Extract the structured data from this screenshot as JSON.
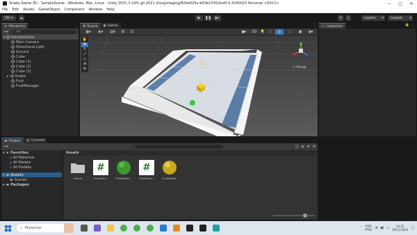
{
  "window": {
    "title": "Snake-Game-3D - SampleScene - Windows, Mac, Linux - Unity 2021.3.10f1.git.2021.3/evg/staging/82bb020e-b03b1330/draft-0.4200023 Personal <DX11>",
    "controls": [
      "—",
      "□",
      "✕"
    ]
  },
  "menu": [
    "File",
    "Edit",
    "Assets",
    "GameObject",
    "Component",
    "Window",
    "Help"
  ],
  "toolbar": {
    "account_label": "DG ▾",
    "play": "▶",
    "pause": "❚❚",
    "step": "▶|",
    "layers_label": "Layers",
    "layout_label": "Layout"
  },
  "hierarchy": {
    "tab": "Hierarchy",
    "search_placeholder": "All",
    "scene": "SampleScene",
    "items": [
      "Main Camera",
      "Directional Light",
      "Ground",
      "Cube",
      "Cube (1)",
      "Cube (2)",
      "Cube (3)",
      "Snake",
      "Fruit",
      "FruitManager"
    ]
  },
  "scene_view": {
    "tabs": [
      "Scene",
      "Game"
    ],
    "mode_2d": "2D",
    "persp_label": "< Persp"
  },
  "inspector": {
    "tab": "Inspector"
  },
  "project": {
    "tabs": [
      "Project",
      "Console"
    ],
    "favorites": {
      "title": "Favorites",
      "items": [
        "All Materials",
        "All Models",
        "All Prefabs"
      ]
    },
    "assets_tree": {
      "title": "Assets",
      "items": [
        "Scenes"
      ]
    },
    "packages": "Packages",
    "breadcrumb": "Assets",
    "assets": [
      {
        "name": "Scenes",
        "kind": "folder"
      },
      {
        "name": "FruitMate...",
        "kind": "script"
      },
      {
        "name": "FruitMateri...",
        "kind": "material-green"
      },
      {
        "name": "SnakeCont...",
        "kind": "script"
      },
      {
        "name": "SnakeMate...",
        "kind": "material-yellow"
      }
    ]
  },
  "taskbar": {
    "search_placeholder": "Pesquisar",
    "lang": "POR",
    "lang2": "PTB2",
    "time": "14:25",
    "date": "26/11/2023"
  },
  "colors": {
    "accent": "#3a79bb",
    "snake": "#3ec43e",
    "fruit": "#e6c027"
  }
}
